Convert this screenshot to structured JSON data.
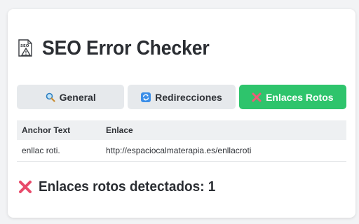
{
  "app": {
    "title": "SEO Error Checker",
    "logo_icon": "seo-warning-icon"
  },
  "tabs": [
    {
      "label": "General",
      "icon": "magnifier-icon",
      "active": false
    },
    {
      "label": "Redirecciones",
      "icon": "refresh-icon",
      "active": false
    },
    {
      "label": "Enlaces Rotos",
      "icon": "red-x-icon",
      "active": true
    }
  ],
  "table": {
    "headers": [
      "Anchor Text",
      "Enlace"
    ],
    "rows": [
      [
        "enllac roti.",
        "http://espaciocalmaterapia.es/enllacroti"
      ]
    ]
  },
  "summary": {
    "text": "Enlaces rotos detectados: 1",
    "icon": "red-x-icon"
  },
  "colors": {
    "accent": "#2ec46c",
    "error": "#e84a6a",
    "tab_bg": "#e6e9ec"
  }
}
